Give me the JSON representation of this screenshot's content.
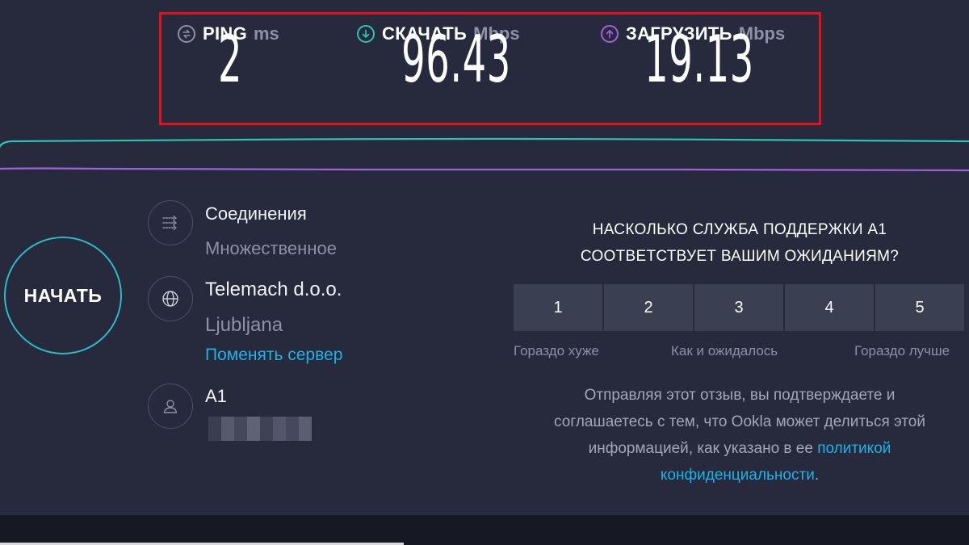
{
  "results": {
    "ping": {
      "label": "PING",
      "unit": "ms",
      "value": "2",
      "icon": "ping-icon",
      "color": "#8d90a6"
    },
    "download": {
      "label": "СКАЧАТЬ",
      "unit": "Mbps",
      "value": "96.43",
      "icon": "download-arrow-icon",
      "color": "#2fc2b4"
    },
    "upload": {
      "label": "ЗАГРУЗИТЬ",
      "unit": "Mbps",
      "value": "19.13",
      "icon": "upload-arrow-icon",
      "color": "#a062dc"
    }
  },
  "start": {
    "label": "НАЧАТЬ"
  },
  "connection": {
    "title": "Соединения",
    "value": "Множественное",
    "icon": "connections-icon"
  },
  "server": {
    "name": "Telemach d.o.o.",
    "location": "Ljubljana",
    "change_link": "Поменять сервер",
    "icon": "globe-icon"
  },
  "provider": {
    "name": "A1",
    "ip_hidden": true,
    "icon": "user-icon"
  },
  "survey": {
    "question_line1": "НАСКОЛЬКО СЛУЖБА ПОДДЕРЖКИ A1",
    "question_line2": "СООТВЕТСТВУЕТ ВАШИМ ОЖИДАНИЯМ?",
    "ratings": [
      "1",
      "2",
      "3",
      "4",
      "5"
    ],
    "scale_low": "Гораздо хуже",
    "scale_mid": "Как и ожидалось",
    "scale_high": "Гораздо лучше",
    "disclaimer_line1": "Отправляя этот отзыв, вы подтверждаете и",
    "disclaimer_line2": "соглашаетесь с тем, что Ookla может делиться этой",
    "disclaimer_line3": "информацией, как указано в ее",
    "privacy_link_part1": "политикой",
    "privacy_link_part2": "конфиденциальности",
    "disclaimer_end": "."
  },
  "colors": {
    "accent_cyan": "#2fc2b4",
    "accent_purple": "#a062dc",
    "link_blue": "#1fb2e8",
    "highlight_red": "#e3101d"
  }
}
